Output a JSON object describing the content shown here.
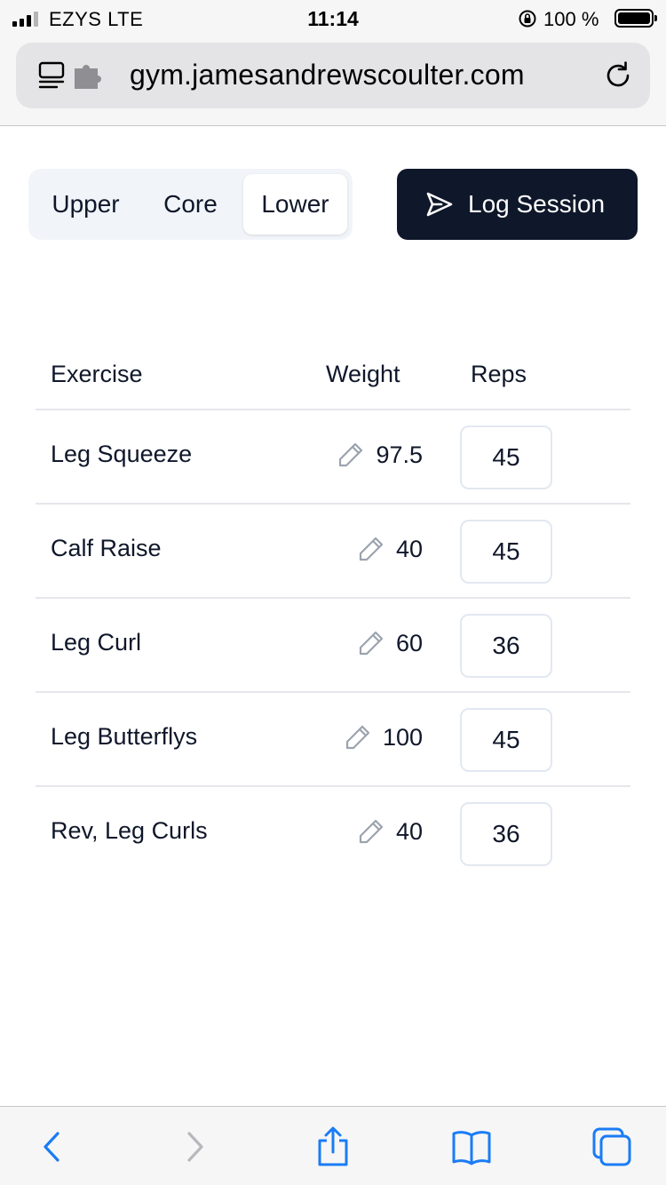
{
  "status_bar": {
    "carrier": "EZYS  LTE",
    "time": "11:14",
    "battery": "100 %"
  },
  "browser": {
    "url": "gym.jamesandrewscoulter.com"
  },
  "segments": {
    "items": [
      {
        "label": "Upper",
        "active": false
      },
      {
        "label": "Core",
        "active": false
      },
      {
        "label": "Lower",
        "active": true
      }
    ]
  },
  "log_button": {
    "label": "Log Session",
    "icon": "send-icon"
  },
  "table": {
    "headers": {
      "exercise": "Exercise",
      "weight": "Weight",
      "reps": "Reps"
    },
    "rows": [
      {
        "exercise": "Leg Squeeze",
        "weight": "97.5",
        "reps": "45"
      },
      {
        "exercise": "Calf Raise",
        "weight": "40",
        "reps": "45"
      },
      {
        "exercise": "Leg Curl",
        "weight": "60",
        "reps": "36"
      },
      {
        "exercise": "Leg Butterflys",
        "weight": "100",
        "reps": "45"
      },
      {
        "exercise": "Rev, Leg Curls",
        "weight": "40",
        "reps": "36"
      }
    ]
  },
  "colors": {
    "accent": "#0f172a",
    "safari_blue": "#1a7cf5",
    "segment_bg": "#f1f5f9"
  }
}
